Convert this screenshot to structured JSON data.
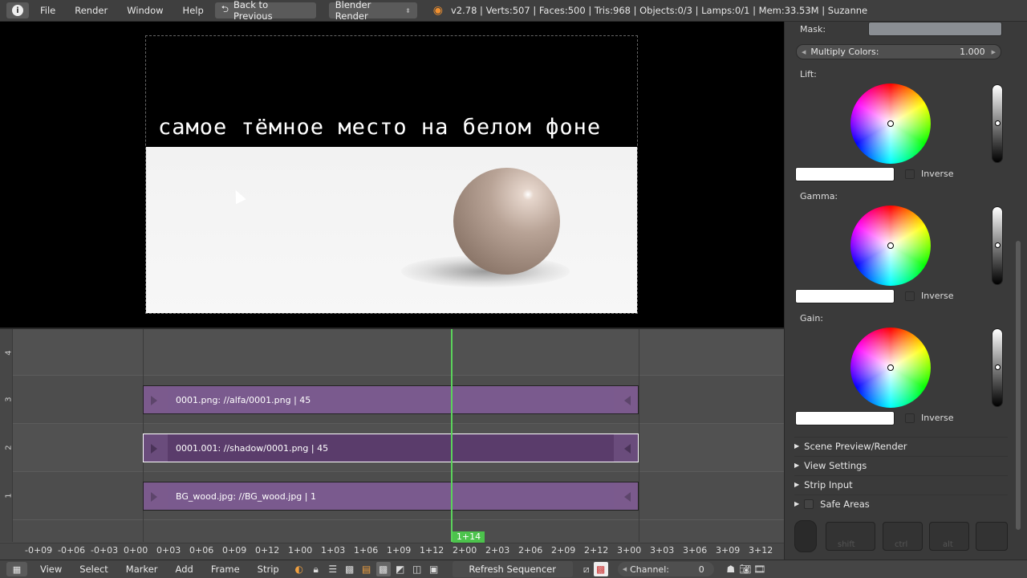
{
  "topbar": {
    "menu": [
      "File",
      "Render",
      "Window",
      "Help"
    ],
    "back_label": "Back to Previous",
    "engine": "Blender Render",
    "stats": "v2.78 | Verts:507 | Faces:500 | Tris:968 | Objects:0/3 | Lamps:0/1 | Mem:33.53M | Suzanne"
  },
  "preview": {
    "caption": "самое тёмное место на белом фоне"
  },
  "sequencer": {
    "channels": [
      "4",
      "3",
      "2",
      "1"
    ],
    "strips": [
      {
        "label": "0001.png: //alfa/0001.png | 45"
      },
      {
        "label": "0001.001: //shadow/0001.png | 45"
      },
      {
        "label": "BG_wood.jpg: //BG_wood.jpg | 1"
      }
    ],
    "current_frame": "1+14",
    "ticks": [
      "-0+09",
      "-0+06",
      "-0+03",
      "0+00",
      "0+03",
      "0+06",
      "0+09",
      "0+12",
      "1+00",
      "1+03",
      "1+06",
      "1+09",
      "1+12",
      "2+00",
      "2+03",
      "2+06",
      "2+09",
      "2+12",
      "3+00",
      "3+03",
      "3+06",
      "3+09",
      "3+12"
    ]
  },
  "right_panel": {
    "mask_label": "Mask:",
    "multiply_label": "Multiply Colors:",
    "multiply_value": "1.000",
    "lift_label": "Lift:",
    "gamma_label": "Gamma:",
    "gain_label": "Gain:",
    "inverse_label": "Inverse",
    "sections": [
      "Scene Preview/Render",
      "View Settings",
      "Strip Input",
      "Safe Areas"
    ],
    "keys": [
      "shift",
      "ctrl",
      "alt"
    ]
  },
  "bottombar": {
    "menu": [
      "View",
      "Select",
      "Marker",
      "Add",
      "Frame",
      "Strip"
    ],
    "refresh_label": "Refresh Sequencer",
    "channel_label": "Channel:",
    "channel_value": "0"
  },
  "colors": {
    "strip": "#6e4f80",
    "playhead": "#5bd35b",
    "background": "#3d3d3d"
  }
}
